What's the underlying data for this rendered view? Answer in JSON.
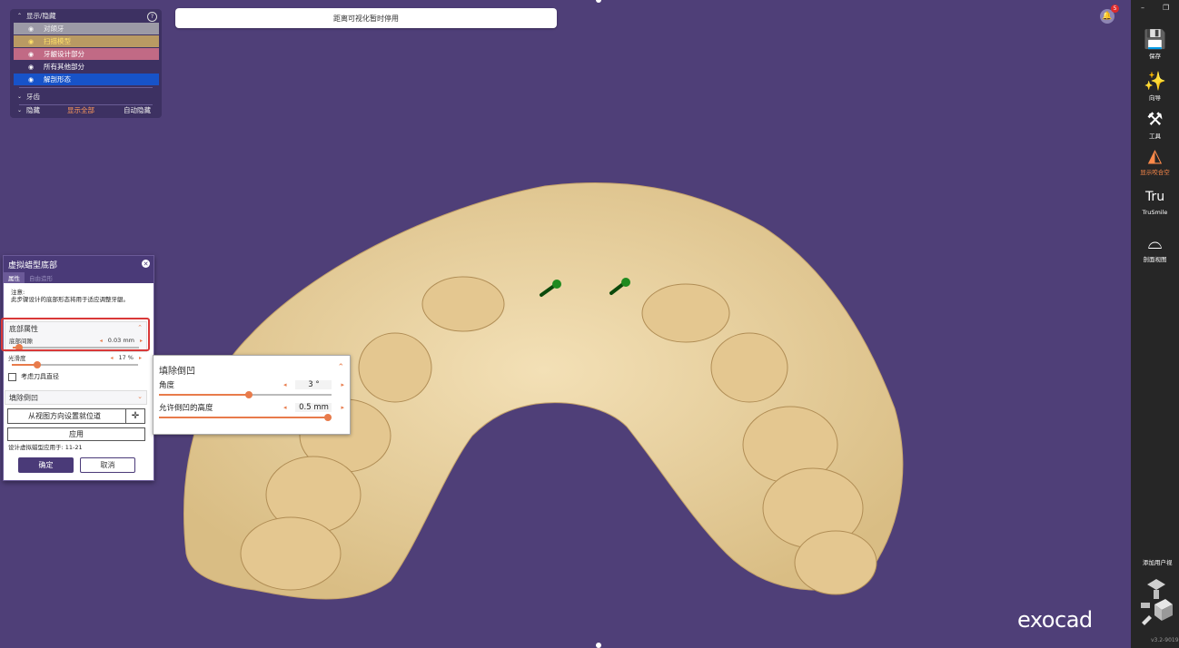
{
  "status_message": "距离可视化暂时停用",
  "notifications": {
    "count": "5"
  },
  "visibility_panel": {
    "header": "显示/隐藏",
    "help": "?",
    "items": [
      {
        "label": "对颌牙",
        "bg": "#9c9aa6",
        "color": "#f2f2f2"
      },
      {
        "label": "扫描模型",
        "bg": "#b99a63",
        "color": "#ffe06a"
      },
      {
        "label": "牙龈设计部分",
        "bg": "#c16a85",
        "color": "#ffffff"
      },
      {
        "label": "所有其他部分",
        "bg": "#3d3162",
        "color": "#ffffff"
      },
      {
        "label": "解剖形态",
        "bg": "#1753c9",
        "color": "#ffffff"
      }
    ],
    "teeth_section": "牙齿",
    "footer": {
      "hide": "隐藏",
      "show_all": "显示全部",
      "auto_hide": "自动隐藏"
    }
  },
  "dialog": {
    "title": "虚拟蜡型底部",
    "tabs": [
      "属性",
      "自由造形"
    ],
    "note_title": "注意:",
    "note_body": "此步骤设计的底部形态将用于适应调整牙龈。",
    "base_props": {
      "header": "底部属性",
      "gap": {
        "label": "底部间隙",
        "value": "0.03 mm",
        "fraction": 0.05
      }
    },
    "smoothness": {
      "label": "光滑度",
      "value": "17 %",
      "fraction": 0.2
    },
    "tool_diameter": "考虑刀具直径",
    "fill_undercut": "填除倒凹",
    "set_insertion": "从视图方向设置就位道",
    "apply": "应用",
    "applied_to": "设计虚拟蜡型应用于:  11-21",
    "ok": "确定",
    "cancel": "取消"
  },
  "undercut_popup": {
    "title": "填除倒凹",
    "angle": {
      "label": "角度",
      "value": "3 °",
      "fraction": 0.52
    },
    "height": {
      "label": "允许倒凹的高度",
      "value": "0.5 mm",
      "fraction": 0.98
    }
  },
  "toolbar": {
    "items": [
      {
        "label": "保存",
        "icon": "💾"
      },
      {
        "label": "向导",
        "icon": "✨"
      },
      {
        "label": "工具",
        "icon": "⚒"
      },
      {
        "label": "显示咬合空",
        "icon": "◭"
      },
      {
        "label": "TruSmile",
        "icon": "Tru"
      },
      {
        "label": "剖面视图",
        "icon": "⌓"
      }
    ],
    "minimize": "–",
    "restore": "❐",
    "add_view": "添加用户视",
    "version": "v3.2-9019"
  },
  "brand": "exocad",
  "colors": {
    "accent": "#e87b4b",
    "purple": "#4a3a78",
    "background": "#4f3f78",
    "model": "#e9d3a2"
  }
}
